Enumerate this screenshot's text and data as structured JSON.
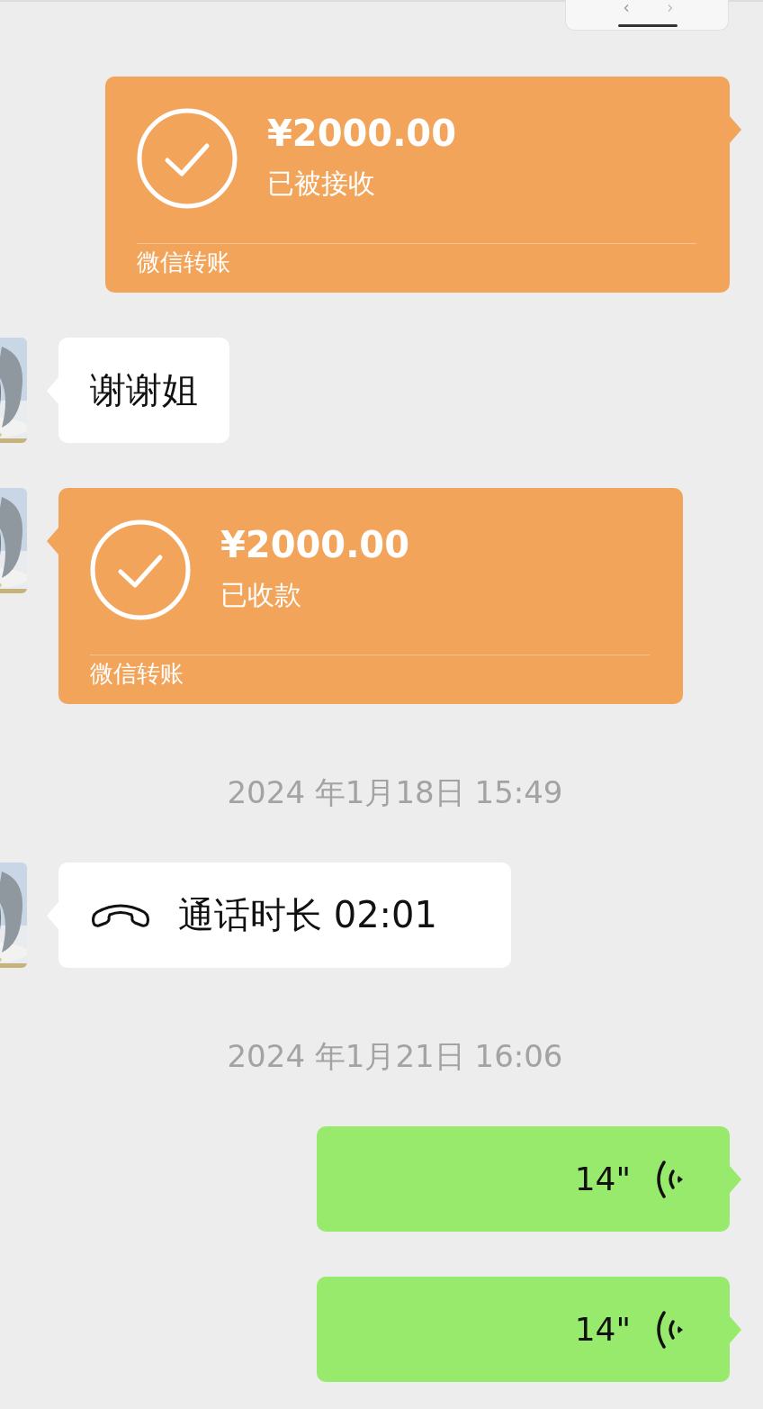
{
  "messages": [
    {
      "kind": "transfer",
      "outgoing": true,
      "amount": "¥2000.00",
      "status": "已被接收",
      "footer": "微信转账"
    },
    {
      "kind": "text",
      "outgoing": false,
      "text": "谢谢姐"
    },
    {
      "kind": "transfer",
      "outgoing": false,
      "amount": "¥2000.00",
      "status": "已收款",
      "footer": "微信转账"
    },
    {
      "kind": "timestamp",
      "text": "2024 年1月18日 15:49"
    },
    {
      "kind": "call",
      "outgoing": false,
      "text": "通话时长 02:01"
    },
    {
      "kind": "timestamp",
      "text": "2024 年1月21日 16:06"
    },
    {
      "kind": "voice",
      "outgoing": true,
      "text": "14\""
    },
    {
      "kind": "voice",
      "outgoing": true,
      "text": "14\""
    }
  ]
}
